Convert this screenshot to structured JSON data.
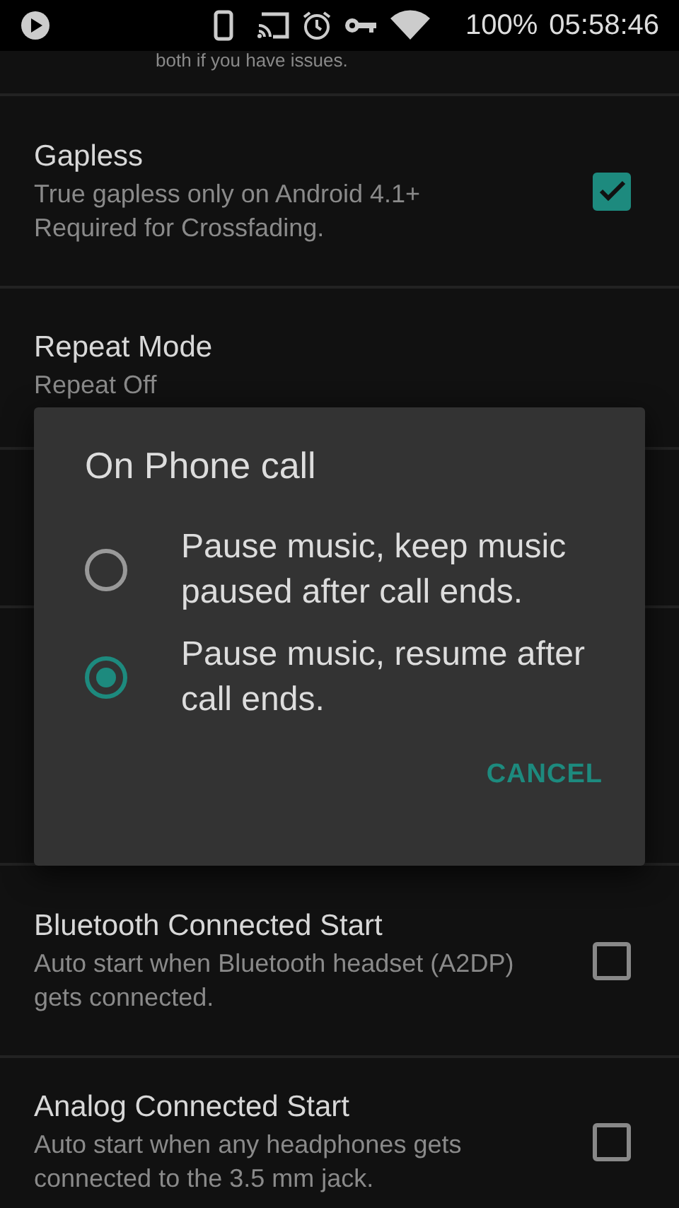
{
  "status_bar": {
    "battery": "100%",
    "time": "05:58:46"
  },
  "settings": [
    {
      "kind": "note",
      "summary": "both if you have issues."
    },
    {
      "kind": "checkbox",
      "title": "Gapless",
      "summary": "True gapless only on Android 4.1+ Required for Crossfading.",
      "checked": true
    },
    {
      "kind": "value",
      "title": "Repeat Mode",
      "summary": "Repeat Off"
    },
    {
      "kind": "hidden"
    },
    {
      "kind": "hidden"
    },
    {
      "kind": "checkbox",
      "title": "Bluetooth Connected Start",
      "summary": "Auto start when Bluetooth headset (A2DP) gets connected.",
      "checked": false
    },
    {
      "kind": "checkbox",
      "title": "Analog Connected Start",
      "summary": "Auto start when any headphones gets connected to the 3.5 mm jack.",
      "checked": false
    }
  ],
  "dialog": {
    "title": "On Phone call",
    "options": [
      {
        "label": "Pause music, keep music paused after call ends.",
        "selected": false
      },
      {
        "label": "Pause music, resume after call ends.",
        "selected": true
      }
    ],
    "button": "CANCEL"
  }
}
